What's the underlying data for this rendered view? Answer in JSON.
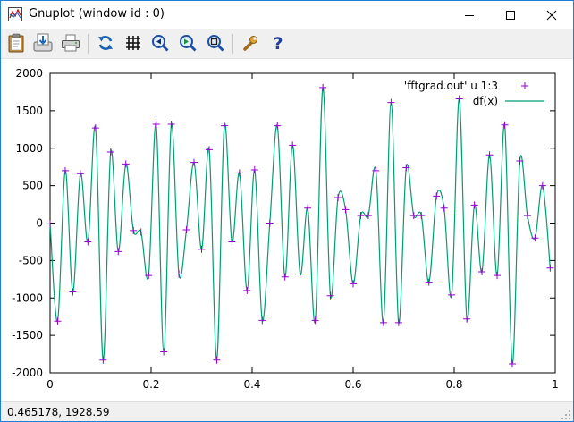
{
  "window": {
    "title": "Gnuplot (window id : 0)"
  },
  "toolbar": {
    "buttons": [
      {
        "name": "copy-clipboard-button",
        "icon": "clipboard-icon"
      },
      {
        "name": "export-button",
        "icon": "export-icon"
      },
      {
        "name": "print-button",
        "icon": "printer-icon"
      },
      {
        "name": "replot-button",
        "icon": "refresh-icon"
      },
      {
        "name": "grid-button",
        "icon": "grid-icon"
      },
      {
        "name": "zoom-prev-button",
        "icon": "zoom-previous-icon"
      },
      {
        "name": "zoom-next-button",
        "icon": "zoom-next-icon"
      },
      {
        "name": "autoscale-button",
        "icon": "autoscale-icon"
      },
      {
        "name": "options-button",
        "icon": "wrench-icon"
      },
      {
        "name": "help-button",
        "icon": "help-icon"
      }
    ]
  },
  "status": {
    "coords": "0.465178,  1928.59"
  },
  "colors": {
    "points": "#9400d3",
    "line": "#009e73",
    "titlebar": "#ffffff",
    "toolbar": "#f0f0f0"
  },
  "chart_data": {
    "type": "line",
    "xlim": [
      0,
      1
    ],
    "ylim": [
      -2000,
      2000
    ],
    "x_ticks": [
      0,
      0.2,
      0.4,
      0.6,
      0.8,
      1
    ],
    "x_tick_labels": [
      "0",
      "0.2",
      "0.4",
      "0.6",
      "0.8",
      "1"
    ],
    "y_ticks": [
      -2000,
      -1500,
      -1000,
      -500,
      0,
      500,
      1000,
      1500,
      2000
    ],
    "y_tick_labels": [
      "-2000",
      "-1500",
      "-1000",
      "-500",
      "0",
      "500",
      "1000",
      "1500",
      "2000"
    ],
    "grid": false,
    "legend_position": "top-right",
    "series": [
      {
        "name": "'fftgrad.out' u 1:3",
        "style": "points",
        "x": [
          0.0,
          0.015,
          0.03,
          0.045,
          0.06,
          0.075,
          0.09,
          0.105,
          0.12,
          0.135,
          0.15,
          0.165,
          0.18,
          0.195,
          0.21,
          0.225,
          0.24,
          0.255,
          0.27,
          0.285,
          0.3,
          0.315,
          0.33,
          0.345,
          0.36,
          0.375,
          0.39,
          0.405,
          0.42,
          0.435,
          0.45,
          0.465,
          0.48,
          0.495,
          0.51,
          0.525,
          0.54,
          0.555,
          0.57,
          0.585,
          0.6,
          0.615,
          0.63,
          0.645,
          0.66,
          0.675,
          0.69,
          0.705,
          0.72,
          0.735,
          0.75,
          0.765,
          0.78,
          0.795,
          0.81,
          0.825,
          0.84,
          0.855,
          0.87,
          0.885,
          0.9,
          0.915,
          0.93,
          0.945,
          0.96,
          0.975,
          0.99
        ],
        "y": [
          -10,
          -1310,
          700,
          -920,
          660,
          -250,
          1270,
          -1830,
          950,
          -380,
          790,
          -100,
          -120,
          -700,
          1320,
          -1720,
          1320,
          -680,
          -90,
          810,
          -350,
          980,
          -1830,
          1300,
          -250,
          670,
          -900,
          710,
          -1300,
          0,
          1300,
          -720,
          1040,
          -680,
          200,
          -1300,
          1810,
          -970,
          340,
          180,
          -810,
          100,
          100,
          700,
          -1330,
          1610,
          -1330,
          740,
          100,
          100,
          -790,
          360,
          200,
          -960,
          1660,
          -1280,
          240,
          -650,
          910,
          -700,
          1310,
          -1880,
          830,
          100,
          -200,
          500,
          -600
        ]
      },
      {
        "name": "df(x)",
        "style": "line",
        "x": [
          0.0,
          0.015,
          0.03,
          0.045,
          0.06,
          0.075,
          0.09,
          0.105,
          0.12,
          0.135,
          0.15,
          0.165,
          0.18,
          0.195,
          0.21,
          0.225,
          0.24,
          0.255,
          0.27,
          0.285,
          0.3,
          0.315,
          0.33,
          0.345,
          0.36,
          0.375,
          0.39,
          0.405,
          0.42,
          0.435,
          0.45,
          0.465,
          0.48,
          0.495,
          0.51,
          0.525,
          0.54,
          0.555,
          0.57,
          0.585,
          0.6,
          0.615,
          0.63,
          0.645,
          0.66,
          0.675,
          0.69,
          0.705,
          0.72,
          0.735,
          0.75,
          0.765,
          0.78,
          0.795,
          0.81,
          0.825,
          0.84,
          0.855,
          0.87,
          0.885,
          0.9,
          0.915,
          0.93,
          0.945,
          0.96,
          0.975,
          0.99
        ],
        "y": [
          -10,
          -1310,
          700,
          -920,
          660,
          -250,
          1270,
          -1830,
          950,
          -380,
          790,
          -100,
          -120,
          -700,
          1320,
          -1720,
          1320,
          -680,
          -90,
          810,
          -350,
          980,
          -1830,
          1300,
          -250,
          670,
          -900,
          710,
          -1300,
          0,
          1300,
          -720,
          1040,
          -680,
          200,
          -1300,
          1810,
          -970,
          340,
          180,
          -810,
          100,
          100,
          700,
          -1330,
          1610,
          -1330,
          740,
          100,
          100,
          -790,
          360,
          200,
          -960,
          1660,
          -1280,
          240,
          -650,
          910,
          -700,
          1310,
          -1880,
          830,
          100,
          -200,
          500,
          -600
        ]
      }
    ]
  }
}
